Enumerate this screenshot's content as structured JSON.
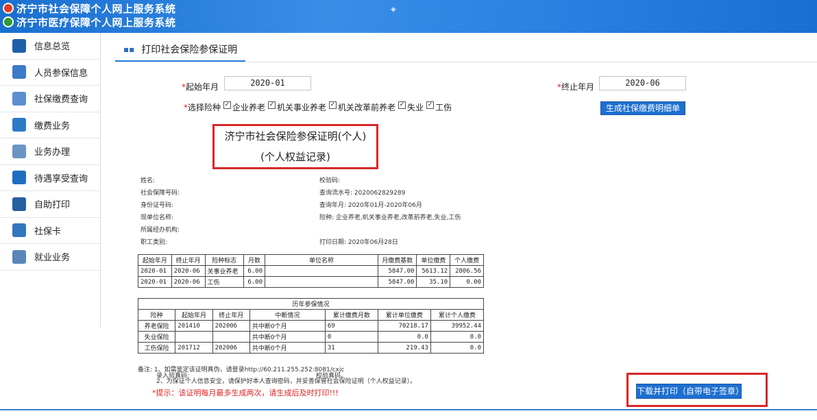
{
  "header": {
    "line1": "济宁市社会保障个人网上服务系统",
    "line2": "济宁市医疗保障个人网上服务系统"
  },
  "sidebar": {
    "items": [
      {
        "label": "信息总览",
        "icon": "overview-icon"
      },
      {
        "label": "人员参保信息",
        "icon": "person-icon"
      },
      {
        "label": "社保缴费查询",
        "icon": "query-icon"
      },
      {
        "label": "缴费业务",
        "icon": "payment-icon"
      },
      {
        "label": "业务办理",
        "icon": "edit-icon"
      },
      {
        "label": "待遇享受查询",
        "icon": "benefit-icon"
      },
      {
        "label": "自助打印",
        "icon": "printer-icon"
      },
      {
        "label": "社保卡",
        "icon": "card-icon"
      },
      {
        "label": "就业业务",
        "icon": "employment-icon"
      }
    ]
  },
  "tab": {
    "title": "打印社会保险参保证明"
  },
  "form": {
    "start_label": "起始年月",
    "start_value": "2020-01",
    "end_label": "终止年月",
    "end_value": "2020-06",
    "insurance_label": "选择险种",
    "types": [
      "企业养老",
      "机关事业养老",
      "机关改革前养老",
      "失业",
      "工伤"
    ],
    "generate_btn": "生成社保缴费明细单"
  },
  "cert": {
    "title1": "济宁市社会保险参保证明(个人)",
    "title2": "(个人权益记录)",
    "left": [
      "姓名:",
      "社会保障号码:",
      "身份证号码:",
      "现单位名称:",
      "所属经办机构:",
      "职工类别:"
    ],
    "right": [
      "校验码:",
      "查询流水号: 2020062829289",
      "查询年月: 2020年01月-2020年06月",
      "险种:        企业养老,机关事业养老,改革前养老,失业,工伤",
      "",
      "打印日期: 2020年06月28日"
    ]
  },
  "table1": {
    "headers": [
      "起始年月",
      "终止年月",
      "险种标志",
      "月数",
      "单位名称",
      "月缴费基数",
      "单位缴费",
      "个人缴费"
    ],
    "rows": [
      [
        "2020-01",
        "2020-06",
        "关事业养老",
        "6.00",
        "",
        "5847.00",
        "5613.12",
        "2806.56"
      ],
      [
        "2020-01",
        "2020-06",
        "工伤",
        "6.00",
        "",
        "5847.00",
        "35.10",
        "0.00"
      ]
    ]
  },
  "table2": {
    "title": "历年参保情况",
    "headers": [
      "险种",
      "起始年月",
      "终止年月",
      "中断情况",
      "累计缴费月数",
      "累计单位缴费",
      "累计个人缴费"
    ],
    "rows": [
      [
        "养老保险",
        "201410",
        "202006",
        "共中断0个月",
        "69",
        "70218.17",
        "39952.44"
      ],
      [
        "失业保险",
        "",
        "",
        "共中断0个月",
        "0",
        "0.0",
        "0.0"
      ],
      [
        "工伤保险",
        "201712",
        "202006",
        "共中断0个月",
        "31",
        "219.43",
        "0.0"
      ]
    ]
  },
  "notes": {
    "n1": "备注: 1、如需鉴定该证明真伪，请登录http://60.211.255.252:8081/cxjc",
    "n1b": "录入验真码:",
    "n1c": "校验真码。",
    "n2": "2、为保证个人信息安全，请保护好本人查询密码，并妥善保管社会保险证明（个人权益记录）。",
    "hint": "*提示：该证明每月最多生成两次，请生成后及时打印!!!"
  },
  "download_btn": "下载并打印（自带电子签章）",
  "colors": {
    "header": "#2a7fe0",
    "accent": "#1e6fd0",
    "highlight": "#d62828"
  }
}
